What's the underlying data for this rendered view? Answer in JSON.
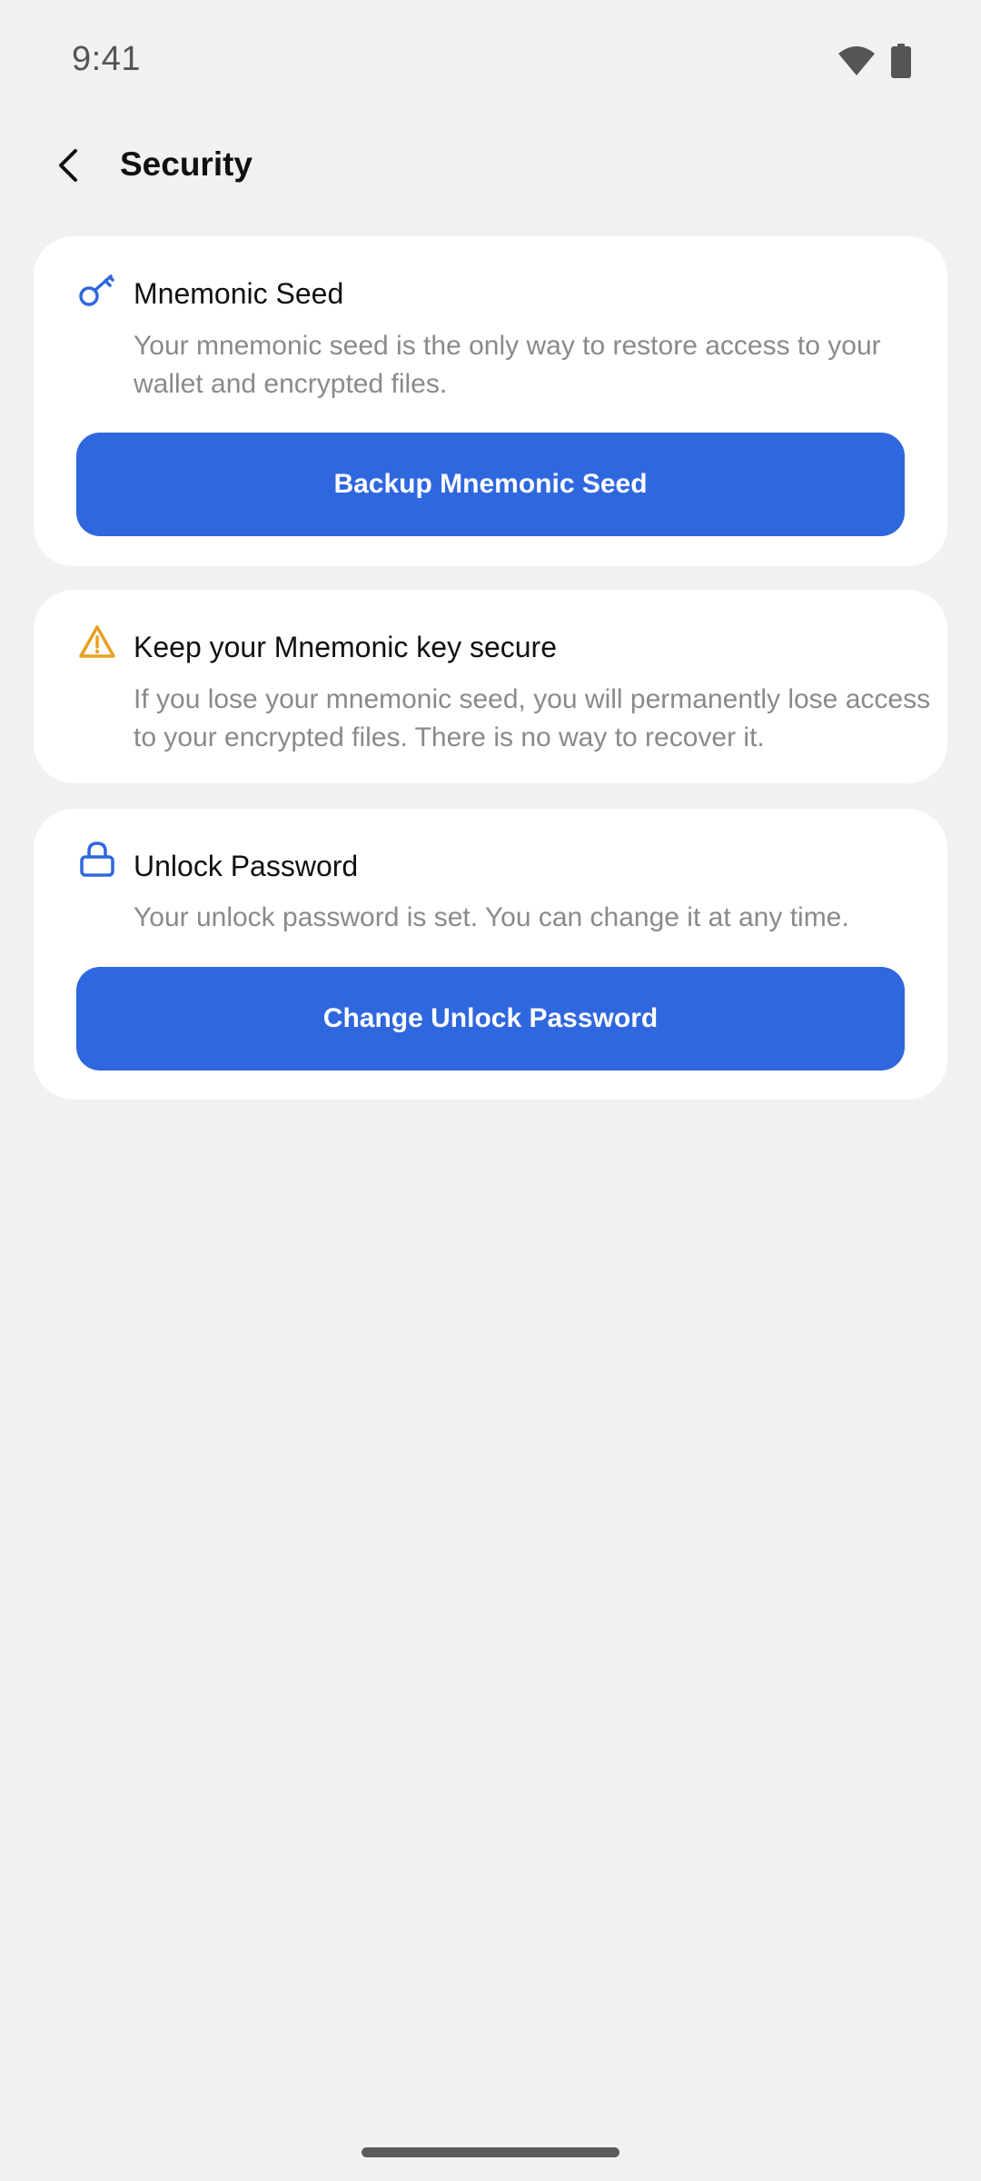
{
  "status_bar": {
    "time": "9:41",
    "icons": [
      "wifi-icon",
      "battery-icon"
    ]
  },
  "app_bar": {
    "title": "Security",
    "back_icon": "chevron-left-icon"
  },
  "cards": [
    {
      "icon": "key-icon",
      "icon_color": "#2F67DE",
      "title": "Mnemonic Seed",
      "description": "Your mnemonic seed is the only way to restore access to your wallet and encrypted files.",
      "button_label": "Backup Mnemonic Seed"
    },
    {
      "icon": "warning-icon",
      "icon_color": "#E8A020",
      "title": "Keep your Mnemonic key secure",
      "description": "If you lose your mnemonic seed, you will permanently lose access to your encrypted files. There is no way to recover it."
    },
    {
      "icon": "lock-icon",
      "icon_color": "#2F67DE",
      "title": "Unlock Password",
      "description": "Your unlock password is set. You can change it at any time.",
      "button_label": "Change Unlock Password"
    }
  ],
  "colors": {
    "background": "#F1F1F1",
    "card": "#FFFFFF",
    "primary": "#2F67DE",
    "warning": "#E8A020",
    "secondary_text": "#8A8A8A"
  }
}
